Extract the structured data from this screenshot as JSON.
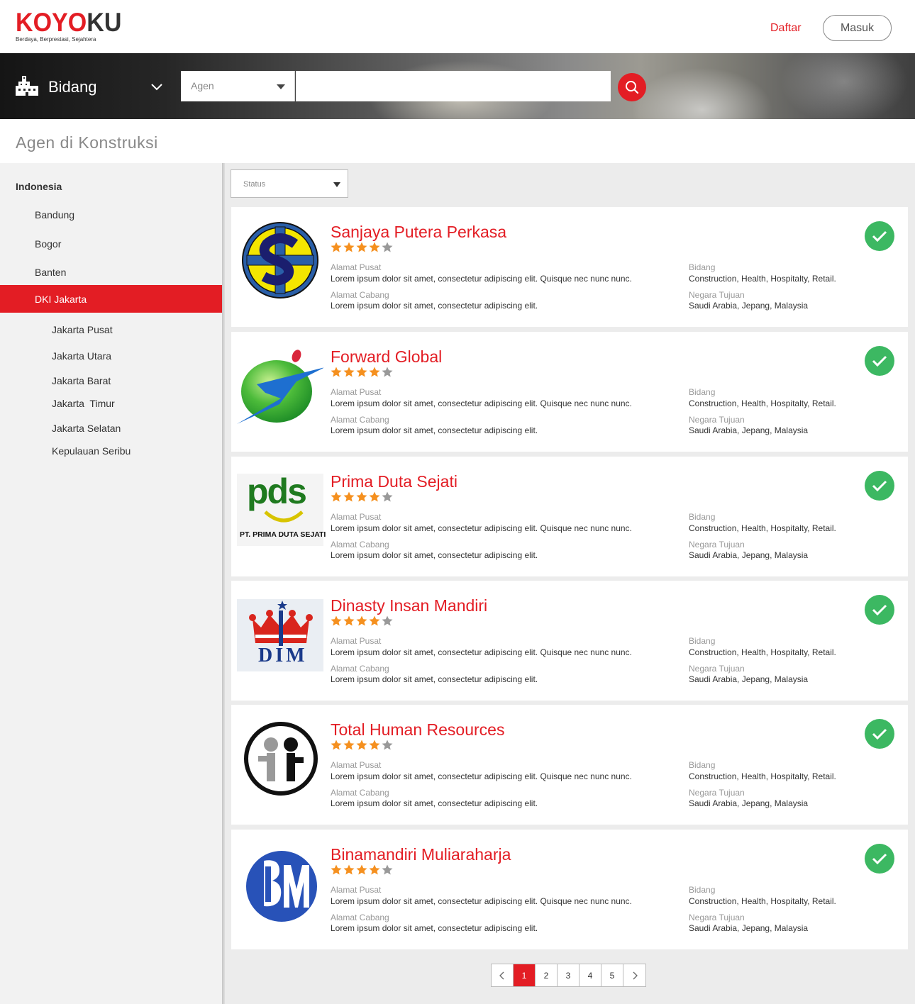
{
  "brand": {
    "logo_red": "KOYO",
    "logo_dark": "KU",
    "tagline": "Berdaya, Berprestasi, Sejahtera"
  },
  "header": {
    "register_label": "Daftar",
    "login_label": "Masuk"
  },
  "search": {
    "category_label": "Bidang",
    "type_label": "Agen",
    "query_value": ""
  },
  "page_title": "Agen di Konstruksi",
  "sidebar": {
    "country": "Indonesia",
    "regions": [
      "Bandung",
      "Bogor",
      "Banten",
      "DKI Jakarta"
    ],
    "active_region": "DKI Jakarta",
    "subregions": [
      "Jakarta Pusat",
      "Jakarta Utara",
      "Jakarta Barat",
      "Jakarta  Timur",
      "Jakarta Selatan",
      "Kepulauan Seribu"
    ]
  },
  "filter": {
    "status_label": "Status"
  },
  "labels": {
    "head_office": "Alamat Pusat",
    "branch_office": "Alamat Cabang",
    "field": "Bidang",
    "destination": "Negara Tujuan"
  },
  "agents": [
    {
      "name": "Sanjaya Putera Perkasa",
      "rating": 4,
      "max_rating": 5,
      "head_office": "Lorem ipsum dolor sit amet, consectetur adipiscing elit. Quisque nec nunc nunc.",
      "branch_office": "Lorem ipsum dolor sit amet, consectetur adipiscing elit.",
      "field": "Construction, Health, Hospitalty, Retail.",
      "destination": "Saudi Arabia, Jepang, Malaysia",
      "verified": true
    },
    {
      "name": "Forward Global",
      "rating": 4,
      "max_rating": 5,
      "head_office": "Lorem ipsum dolor sit amet, consectetur adipiscing elit. Quisque nec nunc nunc.",
      "branch_office": "Lorem ipsum dolor sit amet, consectetur adipiscing elit.",
      "field": "Construction, Health, Hospitalty, Retail.",
      "destination": "Saudi Arabia, Jepang, Malaysia",
      "verified": true
    },
    {
      "name": "Prima Duta Sejati",
      "rating": 4,
      "max_rating": 5,
      "logo_text_main": "pds",
      "logo_text_sub": "PT. PRIMA DUTA SEJATI",
      "head_office": "Lorem ipsum dolor sit amet, consectetur adipiscing elit. Quisque nec nunc nunc.",
      "branch_office": "Lorem ipsum dolor sit amet, consectetur adipiscing elit.",
      "field": "Construction, Health, Hospitalty, Retail.",
      "destination": "Saudi Arabia, Jepang, Malaysia",
      "verified": true
    },
    {
      "name": "Dinasty Insan Mandiri",
      "rating": 4,
      "max_rating": 5,
      "logo_text_main": "DIM",
      "head_office": "Lorem ipsum dolor sit amet, consectetur adipiscing elit. Quisque nec nunc nunc.",
      "branch_office": "Lorem ipsum dolor sit amet, consectetur adipiscing elit.",
      "field": "Construction, Health, Hospitalty, Retail.",
      "destination": "Saudi Arabia, Jepang, Malaysia",
      "verified": true
    },
    {
      "name": "Total Human Resources",
      "rating": 4,
      "max_rating": 5,
      "head_office": "Lorem ipsum dolor sit amet, consectetur adipiscing elit. Quisque nec nunc nunc.",
      "branch_office": "Lorem ipsum dolor sit amet, consectetur adipiscing elit.",
      "field": "Construction, Health, Hospitalty, Retail.",
      "destination": "Saudi Arabia, Jepang, Malaysia",
      "verified": true
    },
    {
      "name": "Binamandiri Muliaraharja",
      "rating": 4,
      "max_rating": 5,
      "head_office": "Lorem ipsum dolor sit amet, consectetur adipiscing elit. Quisque nec nunc nunc.",
      "branch_office": "Lorem ipsum dolor sit amet, consectetur adipiscing elit.",
      "field": "Construction, Health, Hospitalty, Retail.",
      "destination": "Saudi Arabia, Jepang, Malaysia",
      "verified": true
    }
  ],
  "pagination": {
    "prev_icon": "chevron-left-icon",
    "next_icon": "chevron-right-icon",
    "pages": [
      "1",
      "2",
      "3",
      "4",
      "5"
    ],
    "current": "1"
  },
  "colors": {
    "brand_red": "#e31d24",
    "verified_green": "#3cb862",
    "star_filled": "#f5901f",
    "star_empty": "#999999"
  }
}
